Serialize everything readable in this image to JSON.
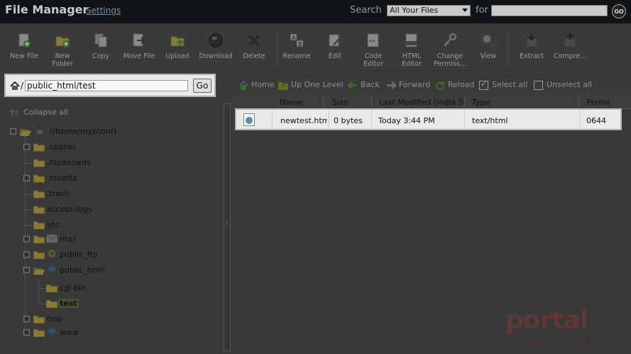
{
  "header": {
    "title": "File Manager",
    "settings_link": "Settings",
    "search_label": "Search",
    "search_scope": "All Your Files",
    "for_label": "for",
    "search_placeholder": "",
    "go_label": "GO"
  },
  "toolbar": {
    "new_file": "New File",
    "new_folder_1": "New",
    "new_folder_2": "Folder",
    "copy": "Copy",
    "move_file": "Move File",
    "upload": "Upload",
    "download": "Download",
    "delete": "Delete",
    "rename": "Rename",
    "edit": "Edit",
    "code_editor_1": "Code",
    "code_editor_2": "Editor",
    "html_editor_1": "HTML",
    "html_editor_2": "Editor",
    "change_perms_1": "Change",
    "change_perms_2": "Permiss...",
    "view": "View",
    "extract": "Extract",
    "compress": "Compre..."
  },
  "path": {
    "prefix": "/",
    "value": "public_html/test",
    "go_label": "Go"
  },
  "tree": {
    "collapse_all": "Collapse all",
    "root": "(/home/mybizinf)",
    "items": [
      {
        "label": ".cpanel"
      },
      {
        "label": ".htpasswds"
      },
      {
        "label": ".mozilla"
      },
      {
        "label": ".trash"
      },
      {
        "label": "access-logs"
      },
      {
        "label": "etc"
      },
      {
        "label": "mail"
      },
      {
        "label": "public_ftp"
      },
      {
        "label": "public_html"
      },
      {
        "label": "cgi-bin"
      },
      {
        "label": "test"
      },
      {
        "label": "tmp"
      },
      {
        "label": "www"
      }
    ]
  },
  "nav": {
    "home": "Home",
    "up": "Up One Level",
    "back": "Back",
    "forward": "Forward",
    "reload": "Reload",
    "select_all": "Select all",
    "unselect_all": "Unselect all"
  },
  "table": {
    "columns": [
      "Name",
      "Size",
      "Last Modified (India Standard Time)",
      "Type",
      "Perms"
    ],
    "rows": [
      {
        "name": "newtest.html",
        "size": "0 bytes",
        "modified": "Today 3:44 PM",
        "type": "text/html",
        "perms": "0644"
      }
    ]
  },
  "watermark": {
    "brand": "portal",
    "tagline": "web hosting"
  },
  "colors": {
    "overlay_bg": "#393939",
    "highlight": "#e9e9e9",
    "topbar": "#101416"
  }
}
